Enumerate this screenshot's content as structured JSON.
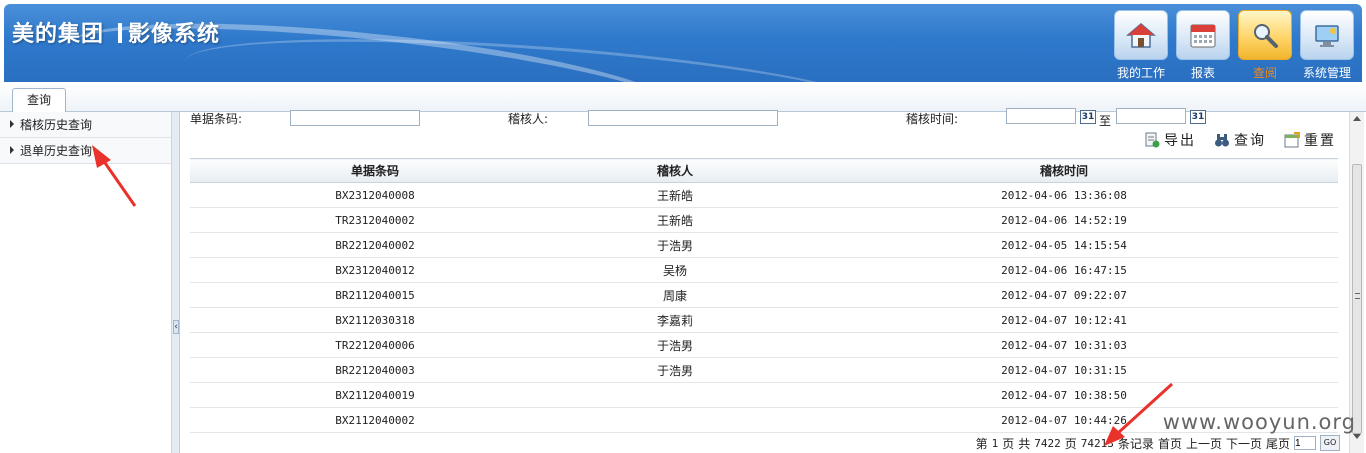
{
  "header": {
    "brand_left": "美的集团",
    "brand_right": "影像系统",
    "nav": [
      {
        "label": "我的工作",
        "icon": "home-icon"
      },
      {
        "label": "报表",
        "icon": "calendar-icon"
      },
      {
        "label": "查阅",
        "icon": "magnifier-icon",
        "active": true
      },
      {
        "label": "系统管理",
        "icon": "monitor-settings-icon"
      }
    ]
  },
  "tabs": [
    {
      "label": "查询"
    }
  ],
  "sidebar": {
    "items": [
      {
        "label": "稽核历史查询"
      },
      {
        "label": "退单历史查询"
      }
    ]
  },
  "search": {
    "code_label": "单据条码:",
    "code_value": "",
    "auditor_label": "稽核人:",
    "auditor_value": "",
    "time_label": "稽核时间:",
    "time_from": "",
    "time_to": "",
    "time_sep": "至",
    "calendar_text": "31"
  },
  "actions": {
    "export": "导出",
    "query": "查询",
    "reset": "重置"
  },
  "table": {
    "columns": [
      "单据条码",
      "稽核人",
      "稽核时间"
    ],
    "rows": [
      [
        "BX2312040008",
        "王新皓",
        "2012-04-06 13:36:08"
      ],
      [
        "TR2312040002",
        "王新皓",
        "2012-04-06 14:52:19"
      ],
      [
        "BR2212040002",
        "于浩男",
        "2012-04-05 14:15:54"
      ],
      [
        "BX2312040012",
        "吴杨",
        "2012-04-06 16:47:15"
      ],
      [
        "BR2112040015",
        "周康",
        "2012-04-07 09:22:07"
      ],
      [
        "BX2112030318",
        "李嘉莉",
        "2012-04-07 10:12:41"
      ],
      [
        "TR2212040006",
        "于浩男",
        "2012-04-07 10:31:03"
      ],
      [
        "BR2212040003",
        "于浩男",
        "2012-04-07 10:31:15"
      ],
      [
        "BX2112040019",
        "",
        "2012-04-07 10:38:50"
      ],
      [
        "BX2112040002",
        "",
        "2012-04-07 10:44:26"
      ]
    ]
  },
  "pager": {
    "prefix": "第",
    "page": "1",
    "page_unit": "页",
    "total_prefix": "共",
    "total_pages": "7422",
    "total_pages_unit": "页",
    "total_records": "74213",
    "records_unit": "条记录",
    "first": "首页",
    "prev": "上一页",
    "next": "下一页",
    "last": "尾页",
    "goto_value": "1",
    "go": "GO"
  },
  "watermark": "www.wooyun.org",
  "colors": {
    "header_blue": "#2f79cc",
    "active_nav_text": "#f08a1c",
    "annotation_red": "#e8322b"
  }
}
